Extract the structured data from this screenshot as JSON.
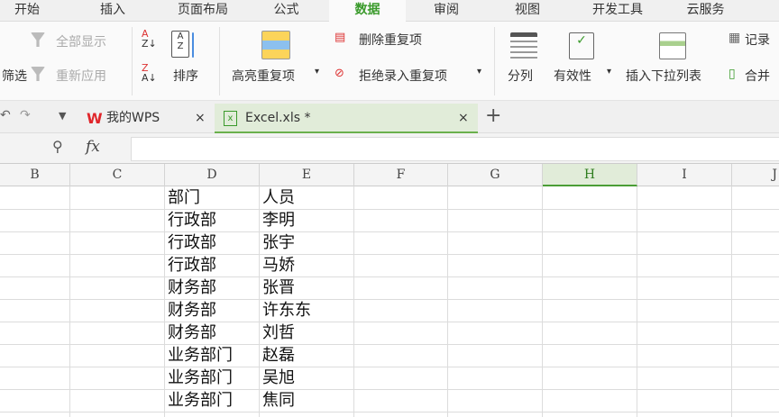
{
  "menu": [
    "开始",
    "插入",
    "页面布局",
    "公式",
    "数据",
    "审阅",
    "视图",
    "开发工具",
    "云服务"
  ],
  "active_menu": "数据",
  "ribbon": {
    "show_all": "全部显示",
    "filter": "筛选",
    "reapply": "重新应用",
    "sort": "排序",
    "highlight_dup": "高亮重复项",
    "delete_dup": "删除重复项",
    "reject_dup": "拒绝录入重复项",
    "split": "分列",
    "validity": "有效性",
    "insert_dropdown": "插入下拉列表",
    "record": "记录",
    "merge": "合并"
  },
  "doctabs": {
    "mywps": "我的WPS",
    "file": "Excel.xls *",
    "close": "×",
    "add": "+"
  },
  "formula": {
    "fx": "fx",
    "value": ""
  },
  "columns": [
    "B",
    "C",
    "D",
    "E",
    "F",
    "G",
    "H",
    "I",
    "J"
  ],
  "selected_column": "H",
  "rows": [
    [
      "部门",
      "人员"
    ],
    [
      "行政部",
      "李明"
    ],
    [
      "行政部",
      "张宇"
    ],
    [
      "行政部",
      "马娇"
    ],
    [
      "财务部",
      "张晋"
    ],
    [
      "财务部",
      "许东东"
    ],
    [
      "财务部",
      "刘哲"
    ],
    [
      "业务部门",
      "赵磊"
    ],
    [
      "业务部门",
      "吴旭"
    ],
    [
      "业务部门",
      "焦同"
    ]
  ],
  "colors": {
    "accent": "#3a9a2b",
    "wps_red": "#e0262b"
  }
}
